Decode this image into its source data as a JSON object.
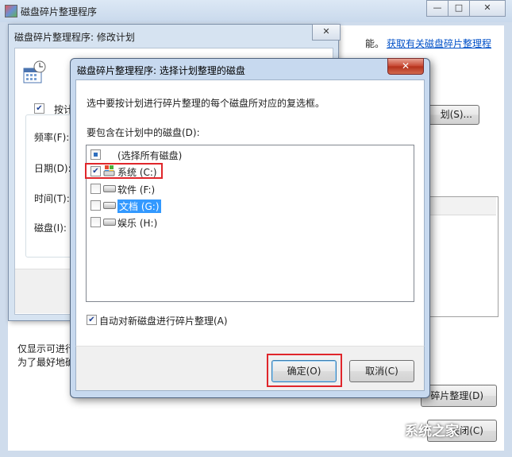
{
  "main_window": {
    "title": "磁盘碎片整理程序",
    "intro_suffix": "能。",
    "help_link": "获取有关磁盘碎片整理程",
    "schedule_button": "划(S)...",
    "defrag_button": "碎片整理(D)",
    "close_button": "关闭(C)",
    "note_line1": "仅显示可进行",
    "note_line2": "为了最好地确",
    "controls": {
      "minimize": "—",
      "maximize": "□",
      "close": "✕"
    }
  },
  "modify_window": {
    "title": "磁盘碎片整理程序: 修改计划",
    "run_on_schedule": "按计",
    "frequency_label": "频率(F):",
    "date_label": "日期(D):",
    "time_label": "时间(T):",
    "disk_label": "磁盘(I):",
    "close_glyph": "✕"
  },
  "dialog": {
    "title": "磁盘碎片整理程序: 选择计划整理的磁盘",
    "close_glyph": "✕",
    "instruction": "选中要按计划进行碎片整理的每个磁盘所对应的复选框。",
    "include_label": "要包含在计划中的磁盘(D):",
    "disks": [
      {
        "label": "(选择所有磁盘)",
        "checked": "partial",
        "icon": "none"
      },
      {
        "label": "系统 (C:)",
        "checked": "true",
        "icon": "system-drive-icon"
      },
      {
        "label": "软件 (F:)",
        "checked": "false",
        "icon": "hard-drive-icon"
      },
      {
        "label": "文档 (G:)",
        "checked": "false",
        "icon": "hard-drive-icon",
        "selected": "true"
      },
      {
        "label": "娱乐 (H:)",
        "checked": "false",
        "icon": "hard-drive-icon"
      }
    ],
    "auto_new_disks": "自动对新磁盘进行碎片整理(A)",
    "ok_button": "确定(O)",
    "cancel_button": "取消(C)"
  },
  "watermark": "系统之家",
  "colors": {
    "highlight_red": "#e0262b",
    "selection_blue": "#3399ff",
    "link_blue": "#0050c8"
  }
}
